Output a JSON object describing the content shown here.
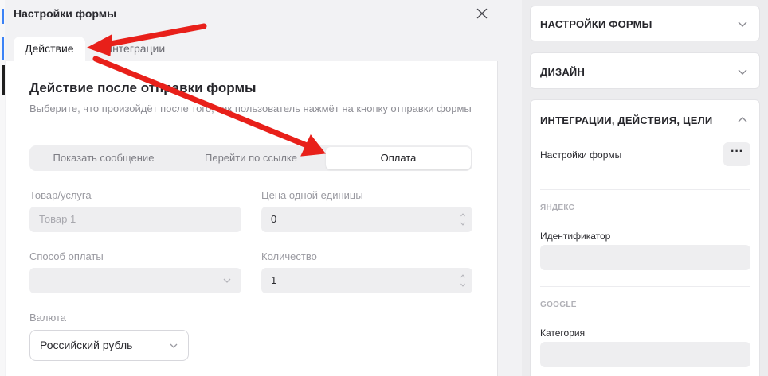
{
  "modal": {
    "title": "Настройки формы",
    "tabs": [
      "Действие",
      "Интеграции"
    ],
    "section_title": "Действие после отправки формы",
    "section_desc": "Выберите, что произойдёт после того, как пользователь нажмёт на кнопку отправки формы",
    "segments": [
      "Показать сообщение",
      "Перейти по ссылке",
      "Оплата"
    ],
    "selected_segment": "Оплата",
    "product": {
      "label": "Товар/услуга",
      "value": "Товар 1"
    },
    "price": {
      "label": "Цена одной единицы",
      "value": "0"
    },
    "payment_method": {
      "label": "Способ оплаты",
      "value": ""
    },
    "quantity": {
      "label": "Количество",
      "value": "1"
    },
    "currency": {
      "label": "Валюта",
      "value": "Российский рубль"
    }
  },
  "sidebar": {
    "panels": [
      {
        "title": "НАСТРОЙКИ ФОРМЫ",
        "expanded": false
      },
      {
        "title": "ДИЗАЙН",
        "expanded": false
      },
      {
        "title": "ИНТЕГРАЦИИ, ДЕЙСТВИЯ, ЦЕЛИ",
        "expanded": true
      }
    ],
    "form_settings_label": "Настройки формы",
    "more_label": "···",
    "yandex_group": "ЯНДЕКС",
    "identifier_label": "Идентификатор",
    "google_group": "GOOGLE",
    "category_label": "Категория"
  },
  "colors": {
    "arrow": "#e8201a",
    "accent_blue": "#3b82f6"
  },
  "icons": [
    "close-icon",
    "chevron-down-icon",
    "chevron-up-icon",
    "spinner-icon",
    "more-icon",
    "arrow-annotation-icon"
  ]
}
